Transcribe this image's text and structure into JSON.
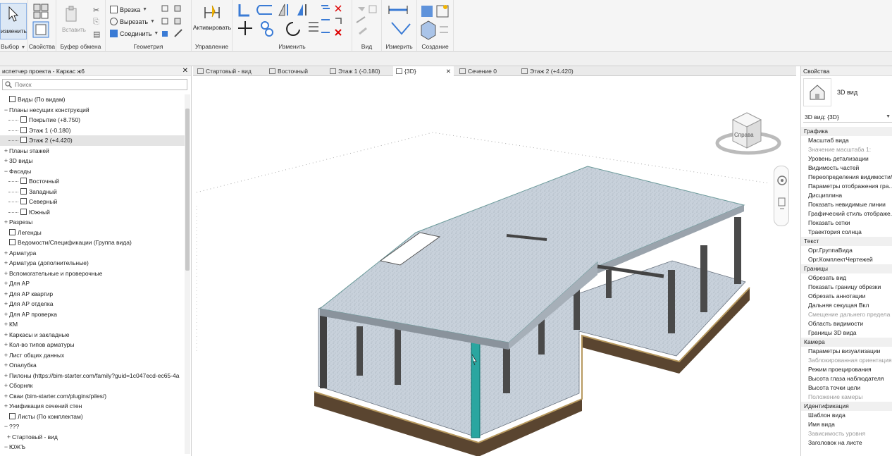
{
  "ribbon": {
    "modify": {
      "label": "изменить",
      "group": "Выбор"
    },
    "properties": {
      "label": "Свойства"
    },
    "clipboard": {
      "paste": "Вставить",
      "group": "Буфер обмена"
    },
    "geometry": {
      "cut": "Врезка",
      "split": "Вырезать",
      "join": "Соединить",
      "group": "Геометрия"
    },
    "control": {
      "activate": "Активировать",
      "group": "Управление"
    },
    "modify_group": {
      "group": "Изменить"
    },
    "view_group": {
      "group": "Вид"
    },
    "measure_group": {
      "group": "Измерить"
    },
    "create_group": {
      "group": "Создание"
    }
  },
  "browser": {
    "title": "испетчер проекта - Каркас ж6",
    "search_placeholder": "Поиск",
    "items": [
      {
        "toggle": "",
        "icon": "views",
        "label": "Виды (По видам)",
        "indent": 0
      },
      {
        "toggle": "−",
        "icon": "",
        "label": "Планы несущих конструкций",
        "indent": 0
      },
      {
        "toggle": "",
        "icon": "view",
        "label": "Покрытие (+8.750)",
        "indent": 2
      },
      {
        "toggle": "",
        "icon": "view",
        "label": "Этаж 1 (-0.180)",
        "indent": 2
      },
      {
        "toggle": "",
        "icon": "view",
        "label": "Этаж 2 (+4.420)",
        "indent": 2,
        "selected": true
      },
      {
        "toggle": "+",
        "icon": "",
        "label": "Планы этажей",
        "indent": 0
      },
      {
        "toggle": "+",
        "icon": "",
        "label": "3D виды",
        "indent": 0
      },
      {
        "toggle": "−",
        "icon": "",
        "label": "Фасады",
        "indent": 0
      },
      {
        "toggle": "",
        "icon": "view",
        "label": "Восточный",
        "indent": 2
      },
      {
        "toggle": "",
        "icon": "view",
        "label": "Западный",
        "indent": 2
      },
      {
        "toggle": "",
        "icon": "view",
        "label": "Северный",
        "indent": 2
      },
      {
        "toggle": "",
        "icon": "view",
        "label": "Южный",
        "indent": 2
      },
      {
        "toggle": "+",
        "icon": "",
        "label": "Разрезы",
        "indent": 0
      },
      {
        "toggle": "",
        "icon": "legend",
        "label": "Легенды",
        "indent": 0
      },
      {
        "toggle": "",
        "icon": "schedule",
        "label": "Ведомости/Спецификации (Группа вида)",
        "indent": 0
      },
      {
        "toggle": "+",
        "icon": "",
        "label": "Арматура",
        "indent": 0
      },
      {
        "toggle": "+",
        "icon": "",
        "label": "Арматура (дополнительные)",
        "indent": 0
      },
      {
        "toggle": "+",
        "icon": "",
        "label": "Вспомогательные и проверочные",
        "indent": 0
      },
      {
        "toggle": "+",
        "icon": "",
        "label": "Для АР",
        "indent": 0
      },
      {
        "toggle": "+",
        "icon": "",
        "label": "Для АР квартир",
        "indent": 0
      },
      {
        "toggle": "+",
        "icon": "",
        "label": "Для АР отделка",
        "indent": 0
      },
      {
        "toggle": "+",
        "icon": "",
        "label": "Для АР проверка",
        "indent": 0
      },
      {
        "toggle": "+",
        "icon": "",
        "label": "КМ",
        "indent": 0
      },
      {
        "toggle": "+",
        "icon": "",
        "label": "Каркасы и закладные",
        "indent": 0
      },
      {
        "toggle": "+",
        "icon": "",
        "label": "Кол-во типов арматуры",
        "indent": 0
      },
      {
        "toggle": "+",
        "icon": "",
        "label": "Лист общих данных",
        "indent": 0
      },
      {
        "toggle": "+",
        "icon": "",
        "label": "Опалубка",
        "indent": 0
      },
      {
        "toggle": "+",
        "icon": "",
        "label": "Пилоны (https://bim-starter.com/family?guid=1c047ecd-ec65-4a",
        "indent": 0
      },
      {
        "toggle": "+",
        "icon": "",
        "label": "Сборняк",
        "indent": 0
      },
      {
        "toggle": "+",
        "icon": "",
        "label": "Сваи (bim-starter.com/plugins/piles/)",
        "indent": 0
      },
      {
        "toggle": "+",
        "icon": "",
        "label": "Унификация сечений стен",
        "indent": 0
      },
      {
        "toggle": "",
        "icon": "sheets",
        "label": "Листы (По комплектам)",
        "indent": 0
      },
      {
        "toggle": "−",
        "icon": "",
        "label": "???",
        "indent": 0
      },
      {
        "toggle": "+",
        "icon": "",
        "label": "Стартовый - вид",
        "indent": 1
      },
      {
        "toggle": "−",
        "icon": "",
        "label": "ЮЖЪ",
        "indent": 0
      }
    ]
  },
  "tabs": [
    {
      "label": "Стартовый - вид",
      "active": false
    },
    {
      "label": "Восточный",
      "active": false
    },
    {
      "label": "Этаж 1 (-0.180)",
      "active": false
    },
    {
      "label": "{3D}",
      "active": true
    },
    {
      "label": "Сечение 0",
      "active": false
    },
    {
      "label": "Этаж 2 (+4.420)",
      "active": false
    }
  ],
  "viewcube": {
    "face_label": "Справа"
  },
  "properties": {
    "title": "Свойства",
    "type_name": "3D вид",
    "type_selector": "3D вид: {3D}",
    "rows": [
      {
        "label": "Графика",
        "group": true
      },
      {
        "label": "Масштаб вида"
      },
      {
        "label": "Значение масштаба   1:",
        "disabled": true
      },
      {
        "label": "Уровень детализации"
      },
      {
        "label": "Видимость частей"
      },
      {
        "label": "Переопределения видимости/"
      },
      {
        "label": "Параметры отображения гра..."
      },
      {
        "label": "Дисциплина"
      },
      {
        "label": "Показать невидимые линии"
      },
      {
        "label": "Графический стиль отображе..."
      },
      {
        "label": "Показать сетки"
      },
      {
        "label": "Траектория солнца"
      },
      {
        "label": "Текст",
        "group": true
      },
      {
        "label": "Орг.ГруппаВида"
      },
      {
        "label": "Орг.КомплектЧертежей"
      },
      {
        "label": "Границы",
        "group": true
      },
      {
        "label": "Обрезать вид"
      },
      {
        "label": "Показать границу обрезки"
      },
      {
        "label": "Обрезать аннотации"
      },
      {
        "label": "Дальняя секущая Вкл"
      },
      {
        "label": "Смещение дальнего предела ...",
        "disabled": true
      },
      {
        "label": "Область видимости"
      },
      {
        "label": "Границы 3D вида"
      },
      {
        "label": "Камера",
        "group": true
      },
      {
        "label": "Параметры визуализации"
      },
      {
        "label": "Заблокированная ориентация",
        "disabled": true
      },
      {
        "label": "Режим проецирования"
      },
      {
        "label": "Высота глаза наблюдателя"
      },
      {
        "label": "Высота точки цели"
      },
      {
        "label": "Положение камеры",
        "disabled": true
      },
      {
        "label": "Идентификация",
        "group": true
      },
      {
        "label": "Шаблон вида"
      },
      {
        "label": "Имя вида"
      },
      {
        "label": "Зависимость уровня",
        "disabled": true
      },
      {
        "label": "Заголовок на листе"
      }
    ]
  },
  "colors": {
    "accent": "#3a7bd5",
    "slab": "#c9d2dc",
    "selected_column": "#2aa6a0",
    "foundation": "#5a4530"
  }
}
